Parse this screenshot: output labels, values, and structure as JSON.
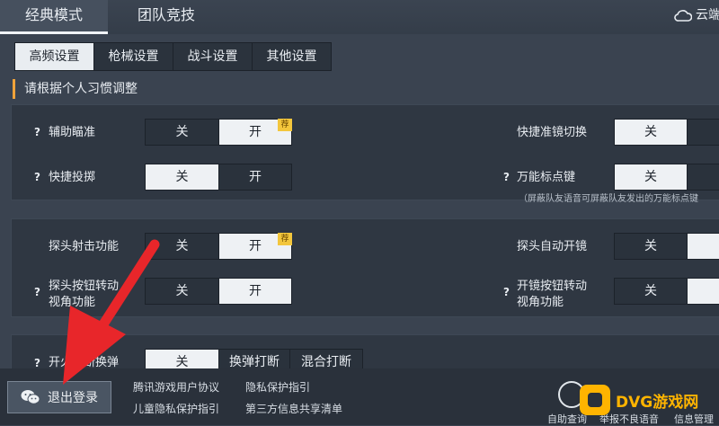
{
  "mode_tabs": [
    {
      "label": "经典模式",
      "active": true
    },
    {
      "label": "团队竞技",
      "active": false
    }
  ],
  "cloud_label": "云端",
  "cloud_icon": "cloud-icon",
  "sub_tabs": [
    {
      "label": "高频设置",
      "active": true
    },
    {
      "label": "枪械设置",
      "active": false
    },
    {
      "label": "战斗设置",
      "active": false
    },
    {
      "label": "其他设置",
      "active": false
    }
  ],
  "hint": "请根据个人习惯调整",
  "settings": {
    "aim_assist": {
      "label": "辅助瞄准",
      "off": "关",
      "on": "开",
      "selected": "on",
      "badge": "荐"
    },
    "quick_throw": {
      "label": "快捷投掷",
      "off": "关",
      "on": "开",
      "selected": "off"
    },
    "quick_scope_switch": {
      "label": "快捷准镜切换",
      "off": "关",
      "selected": "off"
    },
    "universal_marker": {
      "label": "万能标点键",
      "off": "关",
      "selected": "off",
      "note": "（屏蔽队友语音可屏蔽队友发出的万能标点键"
    },
    "peek_fire": {
      "label": "探头射击功能",
      "off": "关",
      "on": "开",
      "selected": "on",
      "badge": "荐"
    },
    "peek_auto_scope": {
      "label": "探头自动开镜",
      "off": "关",
      "selected": "off"
    },
    "peek_button_rotate": {
      "label_line1": "探头按钮转动",
      "label_line2": "视角功能",
      "off": "关",
      "on": "开",
      "selected": "on"
    },
    "scope_button_rotate": {
      "label_line1": "开镜按钮转动",
      "label_line2": "视角功能",
      "off": "关",
      "selected": "off"
    },
    "fire_interrupt_reload": {
      "label": "开火打断换弹",
      "off": "关",
      "opt2": "换弹打断",
      "opt3": "混合打断",
      "selected": "off"
    }
  },
  "bottom": {
    "logout_label": "退出登录",
    "links": [
      "腾讯游戏用户协议",
      "隐私保护指引",
      "儿童隐私保护指引",
      "第三方信息共享清单"
    ],
    "self_query": "自助查询",
    "report_voice": "举报不良语音",
    "info_manage": "信息管理"
  },
  "watermark": "DVG游戏网",
  "colors": {
    "accent_orange": "#f0a33a",
    "badge_yellow": "#f3c63c",
    "arrow_red": "#e8262a",
    "watermark": "#ffb400"
  }
}
